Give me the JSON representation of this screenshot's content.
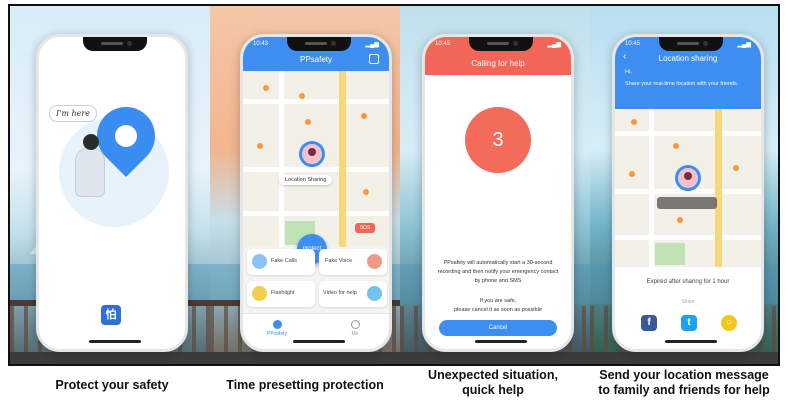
{
  "panels": [
    {
      "caption": "Protect your safety",
      "bubble": "I'm here",
      "logo_glyph": "怕"
    },
    {
      "caption": "Time presetting protection",
      "status_time": "10:43",
      "app_title": "PPsafety",
      "location_chip": "Location Sharing",
      "sos_label": "SOS",
      "protect_label": "protect",
      "tiles": [
        "Fake Calls",
        "Fake Voice",
        "Flashlight",
        "Video for help"
      ],
      "tabs": [
        "PPsafety",
        "Me"
      ]
    },
    {
      "caption_line1": "Unexpected situation,",
      "caption_line2": "quick help",
      "status_time": "10:45",
      "title": "Calling for help",
      "countdown": "3",
      "message": "PPsafety will automatically start a 30-second recording and then notify your emergency contact by phone and SMS",
      "safe_line1": "If you are safe,",
      "safe_line2": "please cancel it as soon as possible",
      "cancel_label": "Cancel"
    },
    {
      "caption_line1": "Send your location message",
      "caption_line2": "to family and friends for help",
      "status_time": "10:45",
      "title": "Location sharing",
      "greeting": "Hi,",
      "description": "Share your real-time location with your friends.",
      "expired": "Expired after sharing for 1 hour",
      "share_label": "Share",
      "share_icons": [
        "facebook-icon",
        "twitter-icon",
        "message-icon"
      ]
    }
  ],
  "colors": {
    "blue": "#3d8ef0",
    "red": "#f2665a",
    "facebook": "#3b5998",
    "twitter": "#1da1f2",
    "message": "#f5c518"
  }
}
